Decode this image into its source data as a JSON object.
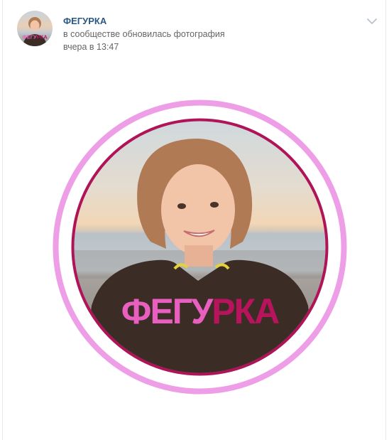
{
  "post": {
    "author_name": "ФЕГУРКА",
    "action_text": "в сообществе обновилась фотография",
    "timestamp": "вчера в 13:47",
    "avatar_icon": "community-avatar",
    "menu_icon": "chevron-down-icon",
    "photo": {
      "overlay_left": "ФЕГУ",
      "overlay_right": "РКА",
      "overlay_left_color": "#e95fc0",
      "overlay_right_color": "#b8145e",
      "ring_outer_color": "#ee9ee6",
      "ring_inner_color": "#b01458"
    }
  },
  "colors": {
    "author_link": "#2a5885",
    "meta_text": "#656565",
    "border": "#e7e8ec"
  }
}
